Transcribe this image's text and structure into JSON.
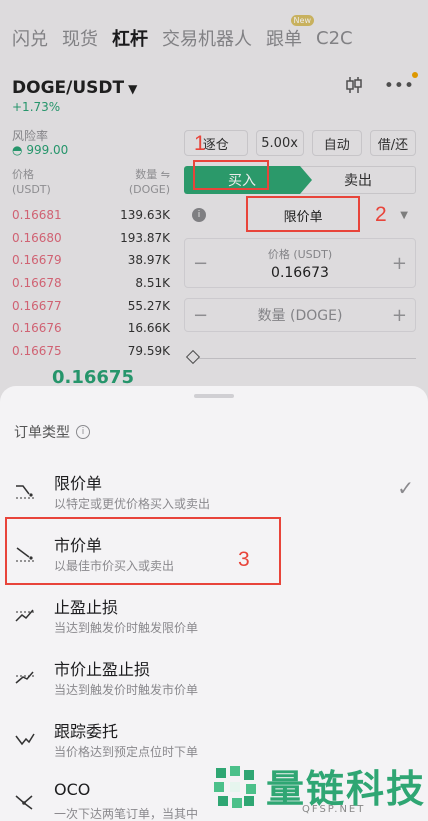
{
  "nav": {
    "tabs": [
      "闪兑",
      "现货",
      "杠杆",
      "交易机器人",
      "跟单",
      "C2C"
    ],
    "active": 2,
    "new_badge": "New"
  },
  "pair": {
    "symbol": "DOGE/USDT",
    "change": "+1.73%"
  },
  "risk": {
    "label": "风险率",
    "value": "999.00"
  },
  "orderbook": {
    "price_header": "价格\n(USDT)",
    "qty_header": "数量 ⇋\n(DOGE)",
    "rows": [
      {
        "price": "0.16681",
        "qty": "139.63K",
        "fill": 0.46
      },
      {
        "price": "0.16680",
        "qty": "193.87K",
        "fill": 0.4
      },
      {
        "price": "0.16679",
        "qty": "38.97K",
        "fill": 0.08
      },
      {
        "price": "0.16678",
        "qty": "8.51K",
        "fill": 0.03
      },
      {
        "price": "0.16677",
        "qty": "55.27K",
        "fill": 0.12
      },
      {
        "price": "0.16676",
        "qty": "16.66K",
        "fill": 0.05
      },
      {
        "price": "0.16675",
        "qty": "79.59K",
        "fill": 0.16
      }
    ],
    "last_price": "0.16675"
  },
  "controls": {
    "margin_mode": "逐仓",
    "leverage": "5.00x",
    "auto": "自动",
    "borrow": "借/还"
  },
  "side": {
    "buy": "买入",
    "sell": "卖出"
  },
  "order_type_selected": "限价单",
  "price_field": {
    "label": "价格 (USDT)",
    "value": "0.16673"
  },
  "qty_field": {
    "label": "数量 (DOGE)"
  },
  "sheet": {
    "title": "订单类型",
    "options": [
      {
        "title": "限价单",
        "desc": "以特定或更优价格买入或卖出",
        "selected": true
      },
      {
        "title": "市价单",
        "desc": "以最佳市价买入或卖出",
        "selected": false
      },
      {
        "title": "止盈止损",
        "desc": "当达到触发价时触发限价单",
        "selected": false
      },
      {
        "title": "市价止盈止损",
        "desc": "当达到触发价时触发市价单",
        "selected": false
      },
      {
        "title": "跟踪委托",
        "desc": "当价格达到预定点位时下单",
        "selected": false
      },
      {
        "title": "OCO",
        "desc": "一次下达两笔订单，当其中",
        "selected": false
      }
    ]
  },
  "annotations": {
    "n1": "1",
    "n2": "2",
    "n3": "3"
  },
  "watermark": {
    "text": "量链科技",
    "sub": "QFSP.NET"
  },
  "colors": {
    "green": "#2fa673",
    "red_ask": "#e26b7d",
    "annotation": "#e8443a"
  }
}
